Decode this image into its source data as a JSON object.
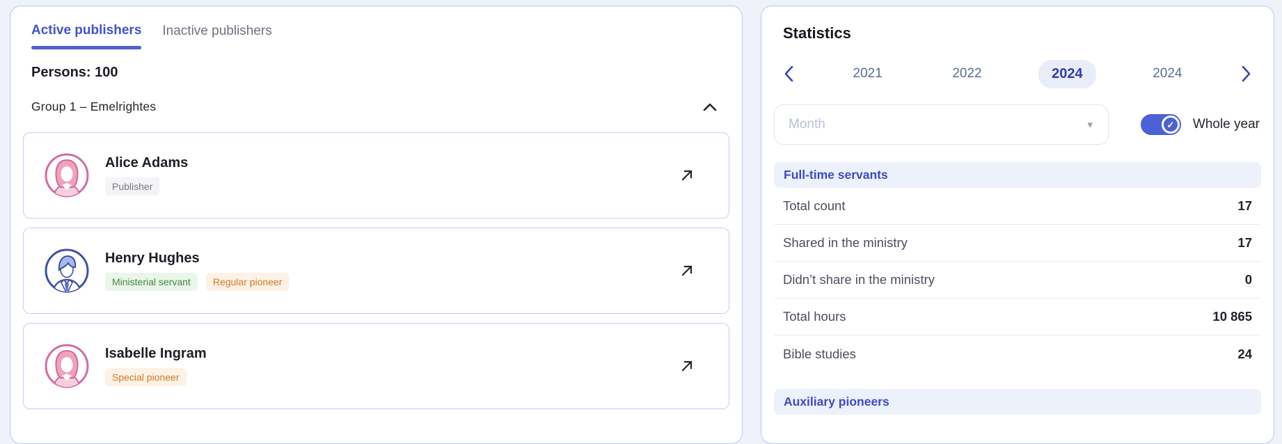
{
  "colors": {
    "accent_blue": "#4c5fd5",
    "selected_year_text": "#2e3fa3",
    "selected_year_bg": "#e9edfa",
    "section_header_text": "#3b4cc4",
    "section_header_bg": "#edf1fc",
    "toggle_on": "#4d61d6",
    "badge_green_text": "#418944",
    "badge_orange_text": "#cc7a2d",
    "badge_gray_text": "#73787f",
    "panel_border": "#b9c5ee",
    "page_bg": "#f0f2fa"
  },
  "icons": {
    "check": "✓",
    "caret": "▾"
  },
  "left_panel": {
    "tabs": {
      "active": "Active publishers",
      "inactive": "Inactive publishers"
    },
    "persons_count_label": "Persons: 100",
    "group": {
      "title": "Group 1 –  Emelrightes"
    },
    "persons": [
      {
        "name": "Alice Adams",
        "avatar": "female-avatar",
        "badges": [
          {
            "label": "Publisher",
            "type": "gray"
          }
        ]
      },
      {
        "name": "Henry Hughes",
        "avatar": "male-avatar",
        "badges": [
          {
            "label": "Ministerial servant",
            "type": "green"
          },
          {
            "label": "Regular pioneer",
            "type": "orange"
          }
        ]
      },
      {
        "name": "Isabelle Ingram",
        "avatar": "female-avatar",
        "badges": [
          {
            "label": "Special pioneer",
            "type": "orange"
          }
        ]
      }
    ]
  },
  "right_panel": {
    "title": "Statistics",
    "year_nav": {
      "years": [
        {
          "label": "2021",
          "selected": false
        },
        {
          "label": "2022",
          "selected": false
        },
        {
          "label": "2024",
          "selected": true
        },
        {
          "label": "2024",
          "selected": false
        }
      ]
    },
    "month_select": {
      "placeholder": "Month",
      "value": ""
    },
    "whole_year": {
      "label": "Whole year",
      "on": true
    },
    "sections": [
      {
        "title": "Full-time servants",
        "rows": [
          {
            "label": "Total count",
            "value": "17"
          },
          {
            "label": "Shared in the ministry",
            "value": "17"
          },
          {
            "label": "Didn’t share in the ministry",
            "value": "0"
          },
          {
            "label": "Total hours",
            "value": "10 865"
          },
          {
            "label": "Bible studies",
            "value": "24"
          }
        ]
      },
      {
        "title": "Auxiliary pioneers",
        "rows": []
      }
    ]
  }
}
